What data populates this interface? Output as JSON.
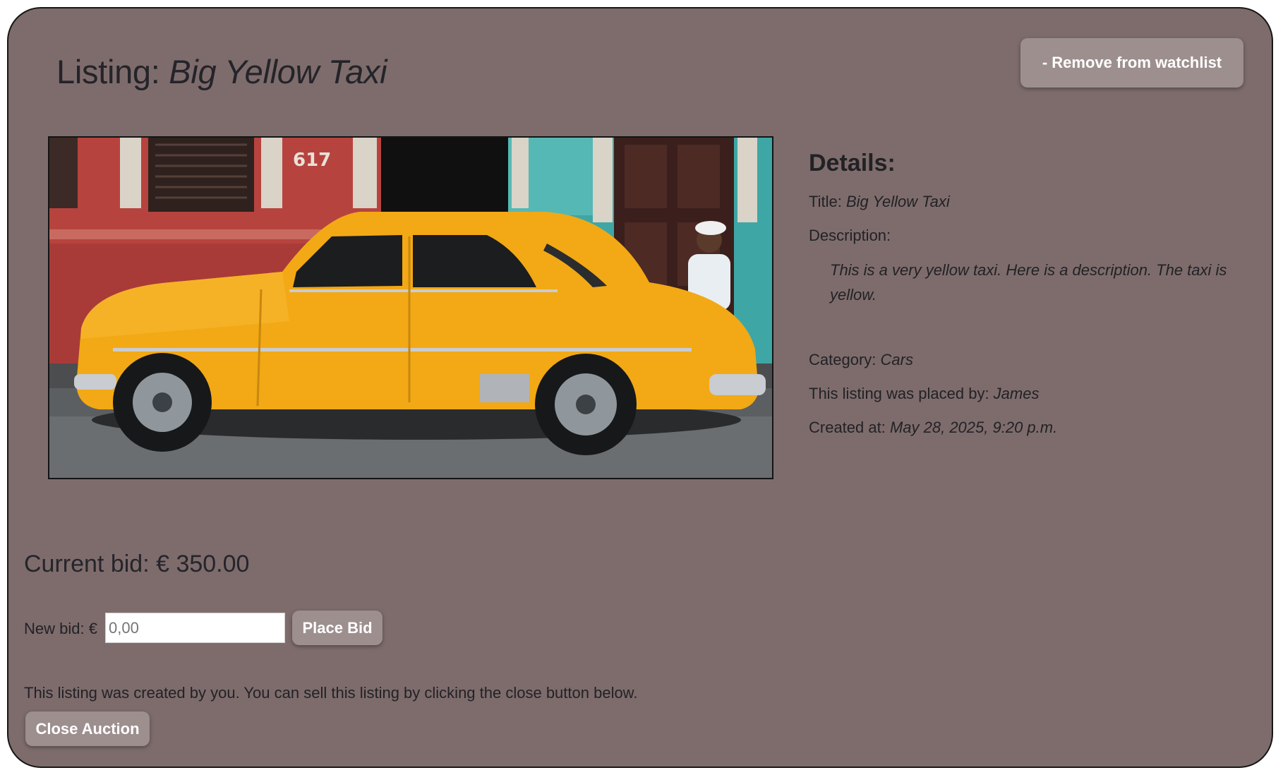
{
  "header": {
    "title_prefix": "Listing: ",
    "title_name": "Big Yellow Taxi",
    "watchlist_button": "- Remove from watchlist"
  },
  "details": {
    "heading": "Details:",
    "title_label": "Title: ",
    "title_value": "Big Yellow Taxi",
    "description_label": "Description:",
    "description_value": "This is a very yellow taxi. Here is a description. The taxi is yellow.",
    "category_label": "Category: ",
    "category_value": "Cars",
    "placed_by_label": "This listing was placed by: ",
    "placed_by_value": "James",
    "created_label": "Created at: ",
    "created_value": "May 28, 2025, 9:20 p.m."
  },
  "bidding": {
    "current_bid": "Current bid: € 350.00",
    "new_bid_label": "New bid: €",
    "new_bid_placeholder": "0,00",
    "place_bid_button": "Place Bid"
  },
  "owner": {
    "note": "This listing was created by you. You can sell this listing by clicking the close button below.",
    "close_button": "Close Auction"
  },
  "image": {
    "subject": "yellow vintage taxi parked on street",
    "building_number": "617"
  },
  "colors": {
    "page_bg": "#7e6c6c",
    "button_bg": "#9e8f8f",
    "text": "#222226"
  }
}
